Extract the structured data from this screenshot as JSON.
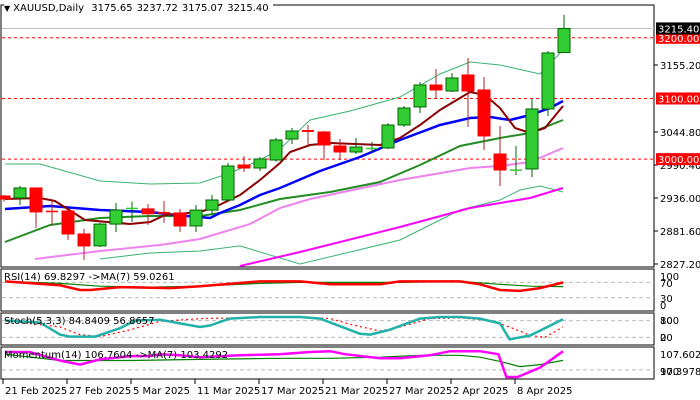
{
  "header": {
    "symbol": "XAUUSD,Daily",
    "open": "3175.65",
    "high": "3237.72",
    "low": "3175.07",
    "close": "3215.40"
  },
  "colors": {
    "bull": "#32cd32",
    "bear": "#ff0000",
    "level": "#ff0000",
    "ma_fast": "#8b0000",
    "ma_mid": "#0000ff",
    "ma_slow": "#228b22",
    "ma_violet": "#ee82ee",
    "ma_magenta": "#ff00ff",
    "bands": "#3cb371",
    "rsi": "#ff0000",
    "stoch": "#20b2aa",
    "momentum": "#ff00ff",
    "signal": "#008000"
  },
  "price_axis": {
    "ticks": [
      "3155.20",
      "3044.80",
      "2990.40",
      "2936.00",
      "2881.60",
      "2827.20"
    ],
    "current_price": "3215.40",
    "levels": [
      "3200.00",
      "3100.00",
      "3000.00"
    ]
  },
  "chart_data": {
    "type": "candlestick",
    "ylim": [
      2827.2,
      3262.3
    ],
    "candles": [
      [
        2939.3,
        2941,
        2930,
        2934.3
      ],
      [
        2936,
        2956,
        2924.5,
        2952.5
      ],
      [
        2952.5,
        2953,
        2886.6,
        2913
      ],
      [
        2915,
        2932,
        2891.5,
        2914
      ],
      [
        2914.6,
        2915,
        2866.8,
        2876.7
      ],
      [
        2876.7,
        2885,
        2834,
        2857
      ],
      [
        2857,
        2895,
        2855,
        2893
      ],
      [
        2893,
        2927.8,
        2880,
        2916.2
      ],
      [
        2919,
        2930,
        2896.5,
        2920
      ],
      [
        2918,
        2926,
        2891.5,
        2910
      ],
      [
        2913,
        2931,
        2895,
        2910
      ],
      [
        2911.3,
        2918,
        2880,
        2889.9
      ],
      [
        2889.9,
        2924.5,
        2880,
        2916
      ],
      [
        2916,
        2941,
        2909.6,
        2932.7
      ],
      [
        2932.7,
        2993.7,
        2931,
        2988.7
      ],
      [
        2990.4,
        3005,
        2978.9,
        2985.4
      ],
      [
        2985.4,
        3003.6,
        2980.5,
        3000.3
      ],
      [
        2998.6,
        3035,
        2996,
        3031.6
      ],
      [
        3033.2,
        3051.4,
        3025,
        3046.4
      ],
      [
        3048,
        3056.3,
        3021.7,
        3044.8
      ],
      [
        3044.8,
        3046.4,
        2998.6,
        3023.3
      ],
      [
        3021.7,
        3033.2,
        2998.6,
        3011.8
      ],
      [
        3011.8,
        3034.9,
        3008.5,
        3020
      ],
      [
        3018.4,
        3028.3,
        3011.8,
        3018.8
      ],
      [
        3018.4,
        3059.6,
        3016.7,
        3056.3
      ],
      [
        3056.3,
        3087.6,
        3053,
        3084.3
      ],
      [
        3086,
        3127.2,
        3076.1,
        3122.2
      ],
      [
        3122.2,
        3148.6,
        3099.2,
        3114
      ],
      [
        3112.3,
        3142,
        3110.7,
        3133.8
      ],
      [
        3138.7,
        3166.7,
        3053,
        3112.3
      ],
      [
        3114,
        3135.4,
        3015.1,
        3038.2
      ],
      [
        3008.5,
        3054.7,
        2955.8,
        2982.1
      ],
      [
        2982,
        3021.7,
        2973.9,
        2983
      ],
      [
        2983.8,
        3099.1,
        2970.6,
        3082.7
      ],
      [
        3082.7,
        3178.3,
        3071.1,
        3175
      ],
      [
        3175.65,
        3237.72,
        3175.07,
        3215.4
      ]
    ],
    "overlays": {
      "ma_fast": [
        [
          0.06,
          2934.3
        ],
        [
          2.25,
          2936
        ],
        [
          3.19,
          2931
        ],
        [
          5.06,
          2899.7
        ],
        [
          7.88,
          2893.1
        ],
        [
          9.13,
          2896.4
        ],
        [
          10.06,
          2908
        ],
        [
          12.25,
          2912.9
        ],
        [
          13.19,
          2921.2
        ],
        [
          14.75,
          2940.9
        ],
        [
          16,
          2965.7
        ],
        [
          17.25,
          2993.7
        ],
        [
          17.88,
          3011.8
        ],
        [
          19.13,
          3023.3
        ],
        [
          20.38,
          3026.6
        ],
        [
          23.5,
          3023.3
        ],
        [
          24.75,
          3034.9
        ],
        [
          26,
          3056.3
        ],
        [
          27.25,
          3081
        ],
        [
          28.5,
          3100.8
        ],
        [
          29.13,
          3110.7
        ],
        [
          30.06,
          3105.7
        ],
        [
          31,
          3084.3
        ],
        [
          31.94,
          3051.4
        ],
        [
          32.88,
          3043.1
        ],
        [
          33.81,
          3051.4
        ],
        [
          34.94,
          3087.6
        ]
      ],
      "ma_mid": [
        [
          0.06,
          2917.9
        ],
        [
          2.88,
          2922.8
        ],
        [
          6,
          2916.2
        ],
        [
          9.13,
          2912.9
        ],
        [
          10.69,
          2908
        ],
        [
          12.88,
          2903
        ],
        [
          13.5,
          2911.3
        ],
        [
          14.75,
          2924.5
        ],
        [
          16,
          2940.9
        ],
        [
          17.25,
          2952.5
        ],
        [
          19.75,
          2980.5
        ],
        [
          22.25,
          3003.6
        ],
        [
          24.75,
          3031.6
        ],
        [
          27.25,
          3056.3
        ],
        [
          29.13,
          3067.8
        ],
        [
          30.38,
          3069.5
        ],
        [
          31.63,
          3064.5
        ],
        [
          32.88,
          3072.8
        ],
        [
          34.13,
          3084.3
        ],
        [
          34.94,
          3095.9
        ]
      ],
      "ma_slow": [
        [
          0.06,
          2863.5
        ],
        [
          2.88,
          2891.5
        ],
        [
          6,
          2903
        ],
        [
          9.13,
          2906.3
        ],
        [
          12.25,
          2906.3
        ],
        [
          14.75,
          2916.2
        ],
        [
          17.25,
          2934.3
        ],
        [
          20.38,
          2945.9
        ],
        [
          23.5,
          2962.4
        ],
        [
          26,
          2990.4
        ],
        [
          28.5,
          3021.7
        ],
        [
          31,
          3034.9
        ],
        [
          32.88,
          3043.1
        ],
        [
          34.94,
          3064.5
        ]
      ],
      "ma_violet": [
        [
          1.94,
          2835.5
        ],
        [
          6,
          2848.7
        ],
        [
          9.75,
          2858.5
        ],
        [
          12.25,
          2868.4
        ],
        [
          15.38,
          2893.1
        ],
        [
          17.25,
          2919.5
        ],
        [
          19.13,
          2934.3
        ],
        [
          24.75,
          2965.7
        ],
        [
          29.13,
          2985.4
        ],
        [
          31,
          2988.7
        ],
        [
          32.88,
          2995.3
        ],
        [
          34.94,
          3018.4
        ]
      ],
      "ma_magenta": [
        [
          14.75,
          2822.3
        ],
        [
          18.5,
          2847
        ],
        [
          24.75,
          2888.2
        ],
        [
          29.13,
          2919.5
        ],
        [
          32.88,
          2936
        ],
        [
          34.94,
          2952.5
        ]
      ],
      "band_upper": [
        [
          0.06,
          2992
        ],
        [
          2.25,
          2992
        ],
        [
          6,
          2964
        ],
        [
          9.13,
          2959
        ],
        [
          12.25,
          2960.7
        ],
        [
          14.13,
          2977.2
        ],
        [
          16,
          2998.6
        ],
        [
          17.25,
          3016.7
        ],
        [
          19.13,
          3064.5
        ],
        [
          21.63,
          3079.4
        ],
        [
          24.75,
          3102.4
        ],
        [
          27.25,
          3140.4
        ],
        [
          29.13,
          3160.1
        ],
        [
          31,
          3155.2
        ],
        [
          33.5,
          3140.4
        ],
        [
          34.94,
          3179.9
        ]
      ],
      "band_lower": [
        [
          6,
          2835.5
        ],
        [
          9.13,
          2845.3
        ],
        [
          12.25,
          2848.7
        ],
        [
          14.75,
          2857
        ],
        [
          17.25,
          2837.1
        ],
        [
          18.5,
          2827.2
        ],
        [
          24.75,
          2866.8
        ],
        [
          28.5,
          2916.2
        ],
        [
          31,
          2932.7
        ],
        [
          32.25,
          2949.2
        ],
        [
          33.5,
          2955.8
        ],
        [
          34.94,
          2945.9
        ]
      ]
    },
    "x_labels": [
      {
        "index": 0,
        "label": "21 Feb 2025"
      },
      {
        "index": 4,
        "label": "27 Feb 2025"
      },
      {
        "index": 8,
        "label": "5 Mar 2025"
      },
      {
        "index": 12,
        "label": "11 Mar 2025"
      },
      {
        "index": 16,
        "label": "17 Mar 2025"
      },
      {
        "index": 20,
        "label": "21 Mar 2025"
      },
      {
        "index": 24,
        "label": "27 Mar 2025"
      },
      {
        "index": 28,
        "label": "2 Apr 2025"
      },
      {
        "index": 32,
        "label": "8 Apr 2025"
      }
    ]
  },
  "indicators": {
    "rsi": {
      "label": "RSI(14) 69.8297  ->MA(7) 59.0261",
      "range": [
        0,
        100
      ],
      "axis": [
        "100",
        "70",
        "30",
        "0"
      ],
      "levels": [
        70,
        30
      ],
      "main": [
        [
          0.06,
          72.5
        ],
        [
          3.5,
          62.5
        ],
        [
          4.75,
          50
        ],
        [
          5.4,
          50
        ],
        [
          7.25,
          57.5
        ],
        [
          10.4,
          55
        ],
        [
          12.25,
          60
        ],
        [
          16,
          72.5
        ],
        [
          18.5,
          72.5
        ],
        [
          20.4,
          65
        ],
        [
          23.5,
          65
        ],
        [
          24.75,
          72.5
        ],
        [
          28.5,
          72.5
        ],
        [
          29.75,
          65
        ],
        [
          31,
          50
        ],
        [
          32.25,
          47.5
        ],
        [
          33.5,
          55
        ],
        [
          34.94,
          69.8
        ]
      ],
      "signal": [
        [
          0.06,
          72.5
        ],
        [
          3.5,
          67.5
        ],
        [
          6,
          60
        ],
        [
          9.1,
          57.5
        ],
        [
          12.25,
          60
        ],
        [
          16,
          67.5
        ],
        [
          18.5,
          70
        ],
        [
          24.75,
          70
        ],
        [
          28.5,
          72.5
        ],
        [
          31,
          65
        ],
        [
          32.9,
          60
        ],
        [
          34.94,
          59
        ]
      ]
    },
    "stoch": {
      "label": "Stoch(5,3,3) 84.8409 56.8657",
      "range": [
        0,
        100
      ],
      "axis": [
        "80",
        "100",
        "0",
        "20"
      ],
      "levels": [
        80,
        20
      ],
      "main": [
        [
          0.06,
          80
        ],
        [
          2.25,
          73
        ],
        [
          3.5,
          30
        ],
        [
          4.1,
          23
        ],
        [
          5.7,
          23
        ],
        [
          7.25,
          53
        ],
        [
          8.2,
          80
        ],
        [
          9.75,
          83
        ],
        [
          11,
          70
        ],
        [
          12.25,
          57
        ],
        [
          12.9,
          63
        ],
        [
          14.1,
          87
        ],
        [
          16,
          93
        ],
        [
          18.5,
          93
        ],
        [
          19.75,
          87
        ],
        [
          21,
          60
        ],
        [
          22.25,
          33
        ],
        [
          22.9,
          30
        ],
        [
          24.1,
          47
        ],
        [
          26,
          87
        ],
        [
          27.25,
          93
        ],
        [
          28.5,
          93
        ],
        [
          29.75,
          87
        ],
        [
          31,
          70
        ],
        [
          31.6,
          13
        ],
        [
          32.9,
          27
        ],
        [
          34.94,
          85
        ]
      ],
      "signal": [
        [
          0.06,
          80
        ],
        [
          3.5,
          57
        ],
        [
          4.75,
          30
        ],
        [
          6,
          23
        ],
        [
          7.9,
          47
        ],
        [
          9.75,
          77
        ],
        [
          12.25,
          87
        ],
        [
          14.75,
          90
        ],
        [
          18.5,
          93
        ],
        [
          20.4,
          87
        ],
        [
          21.6,
          67
        ],
        [
          23.5,
          43
        ],
        [
          24.75,
          57
        ],
        [
          26.6,
          87
        ],
        [
          28.5,
          90
        ],
        [
          30.4,
          80
        ],
        [
          31.6,
          57
        ],
        [
          32.9,
          27
        ],
        [
          33.8,
          20
        ],
        [
          34.94,
          57
        ]
      ]
    },
    "momentum": {
      "label": "Momentum(14) 106.7604  ->MA(7) 103.4292",
      "range": [
        97.3978,
        107.6029
      ],
      "axis": [
        "107.6029",
        "100",
        "97.3978"
      ],
      "levels": [
        100
      ],
      "main": [
        [
          0.06,
          106.5
        ],
        [
          1.6,
          106.5
        ],
        [
          3.5,
          103.4
        ],
        [
          4.75,
          101.9
        ],
        [
          6,
          103.8
        ],
        [
          7.9,
          105
        ],
        [
          9.1,
          105
        ],
        [
          9.75,
          105.7
        ],
        [
          11,
          105.3
        ],
        [
          12.25,
          104.6
        ],
        [
          14.75,
          105.3
        ],
        [
          17.25,
          105.7
        ],
        [
          19.1,
          106.5
        ],
        [
          20.4,
          106.8
        ],
        [
          21.3,
          105.7
        ],
        [
          23.5,
          104.2
        ],
        [
          24.75,
          104.2
        ],
        [
          26.6,
          105.3
        ],
        [
          27.9,
          106.8
        ],
        [
          29.75,
          106.8
        ],
        [
          30.9,
          105.7
        ],
        [
          31.4,
          97.4
        ],
        [
          32.1,
          97.4
        ],
        [
          33.5,
          100.8
        ],
        [
          34.94,
          106.76
        ]
      ],
      "signal": [
        [
          0.06,
          105.7
        ],
        [
          3.5,
          103.4
        ],
        [
          7.9,
          103.4
        ],
        [
          12.25,
          103.8
        ],
        [
          17.25,
          104.2
        ],
        [
          20.4,
          104.2
        ],
        [
          23.5,
          104.6
        ],
        [
          26,
          105.3
        ],
        [
          28.5,
          105.3
        ],
        [
          29.75,
          104.6
        ],
        [
          31,
          103.1
        ],
        [
          32.25,
          101.2
        ],
        [
          33.5,
          101.9
        ],
        [
          34.94,
          103.43
        ]
      ]
    }
  }
}
